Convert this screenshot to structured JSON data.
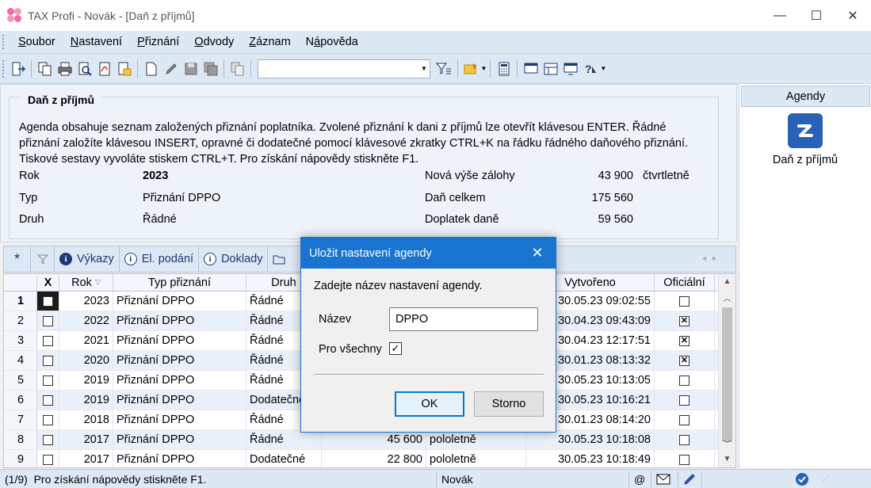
{
  "window": {
    "title": "TAX Profi - Novák - [Daň z příjmů]",
    "minimize": "—",
    "maximize": "☐",
    "close": "✕"
  },
  "menu": {
    "items": [
      {
        "label": "Soubor",
        "hotkey": "S"
      },
      {
        "label": "Nastavení",
        "hotkey": "N"
      },
      {
        "label": "Přiznání",
        "hotkey": "P"
      },
      {
        "label": "Odvody",
        "hotkey": "O"
      },
      {
        "label": "Záznam",
        "hotkey": "Z"
      },
      {
        "label": "Nápověda",
        "hotkey": "á"
      }
    ]
  },
  "toolbar": {
    "combo_value": "",
    "icons": [
      "exit-icon",
      "copy-icon",
      "print-icon",
      "preview-icon",
      "pdf-icon",
      "export-icon",
      "new-icon",
      "edit-icon",
      "save-icon",
      "save-all-icon",
      "duplicate-icon",
      "filter-icon",
      "favorites-icon",
      "calculator-icon",
      "window-icon",
      "layout-icon",
      "screen-icon",
      "help-icon"
    ]
  },
  "info": {
    "title": "Daň z příjmů",
    "description": "Agenda obsahuje seznam založených přiznání poplatníka. Zvolené přiznání k dani z příjmů lze otevřít klávesou ENTER. Řádné přiznání založíte klávesou INSERT, opravné či dodatečné pomocí klávesové zkratky CTRL+K na řádku řádného daňového přiznání. Tiskové sestavy vyvoláte stiskem CTRL+T. Pro získání nápovědy stiskněte F1.",
    "rok_label": "Rok",
    "rok_value": "2023",
    "typ_label": "Typ",
    "typ_value": "Přiznání DPPO",
    "druh_label": "Druh",
    "druh_value": "Řádné",
    "zaloha_label": "Nová výše zálohy",
    "zaloha_value": "43 900",
    "zaloha_period": "čtvrtletně",
    "dan_label": "Daň celkem",
    "dan_value": "175 560",
    "doplatek_label": "Doplatek daně",
    "doplatek_value": "59 560"
  },
  "agendy": {
    "header": "Agendy",
    "item_label": "Daň z příjmů"
  },
  "tabs": {
    "star": "*",
    "vykazy": "Výkazy",
    "el_podani": "El. podání",
    "doklady": "Doklady"
  },
  "grid": {
    "headers": {
      "x": "X",
      "rok": "Rok",
      "typ": "Typ přiznání",
      "druh": "Druh",
      "vytvoreno": "Vytvořeno",
      "oficialni": "Oficiální"
    },
    "rows": [
      {
        "no": "1",
        "rok": "2023",
        "typ": "Přiznání DPPO",
        "druh": "Řádné",
        "castka": "",
        "obdobi": "",
        "vytvoreno": "30.05.23 09:02:55",
        "oficialni": false
      },
      {
        "no": "2",
        "rok": "2022",
        "typ": "Přiznání DPPO",
        "druh": "Řádné",
        "castka": "",
        "obdobi": "",
        "vytvoreno": "30.04.23 09:43:09",
        "oficialni": true
      },
      {
        "no": "3",
        "rok": "2021",
        "typ": "Přiznání DPPO",
        "druh": "Řádné",
        "castka": "",
        "obdobi": "",
        "vytvoreno": "30.04.23 12:17:51",
        "oficialni": true
      },
      {
        "no": "4",
        "rok": "2020",
        "typ": "Přiznání DPPO",
        "druh": "Řádné",
        "castka": "",
        "obdobi": "",
        "vytvoreno": "30.01.23 08:13:32",
        "oficialni": true
      },
      {
        "no": "5",
        "rok": "2019",
        "typ": "Přiznání DPPO",
        "druh": "Řádné",
        "castka": "",
        "obdobi": "",
        "vytvoreno": "30.05.23 10:13:05",
        "oficialni": false
      },
      {
        "no": "6",
        "rok": "2019",
        "typ": "Přiznání DPPO",
        "druh": "Dodatečné",
        "castka": "",
        "obdobi": "",
        "vytvoreno": "30.05.23 10:16:21",
        "oficialni": false
      },
      {
        "no": "7",
        "rok": "2018",
        "typ": "Přiznání DPPO",
        "druh": "Řádné",
        "castka": "",
        "obdobi": "",
        "vytvoreno": "30.01.23 08:14:20",
        "oficialni": false
      },
      {
        "no": "8",
        "rok": "2017",
        "typ": "Přiznání DPPO",
        "druh": "Řádné",
        "castka": "45 600",
        "obdobi": "pololetně",
        "vytvoreno": "30.05.23 10:18:08",
        "oficialni": false
      },
      {
        "no": "9",
        "rok": "2017",
        "typ": "Přiznání DPPO",
        "druh": "Dodatečné",
        "castka": "22 800",
        "obdobi": "pololetně",
        "vytvoreno": "30.05.23 10:18:49",
        "oficialni": false
      }
    ]
  },
  "status": {
    "count": "(1/9)",
    "hint": "Pro získání nápovědy stiskněte F1.",
    "user": "Novák",
    "at": "@"
  },
  "dialog": {
    "title": "Uložit nastavení agendy",
    "prompt": "Zadejte název nastavení agendy.",
    "name_label": "Název",
    "name_value": "DPPO",
    "all_label": "Pro všechny",
    "all_checked": true,
    "ok": "OK",
    "cancel": "Storno"
  }
}
